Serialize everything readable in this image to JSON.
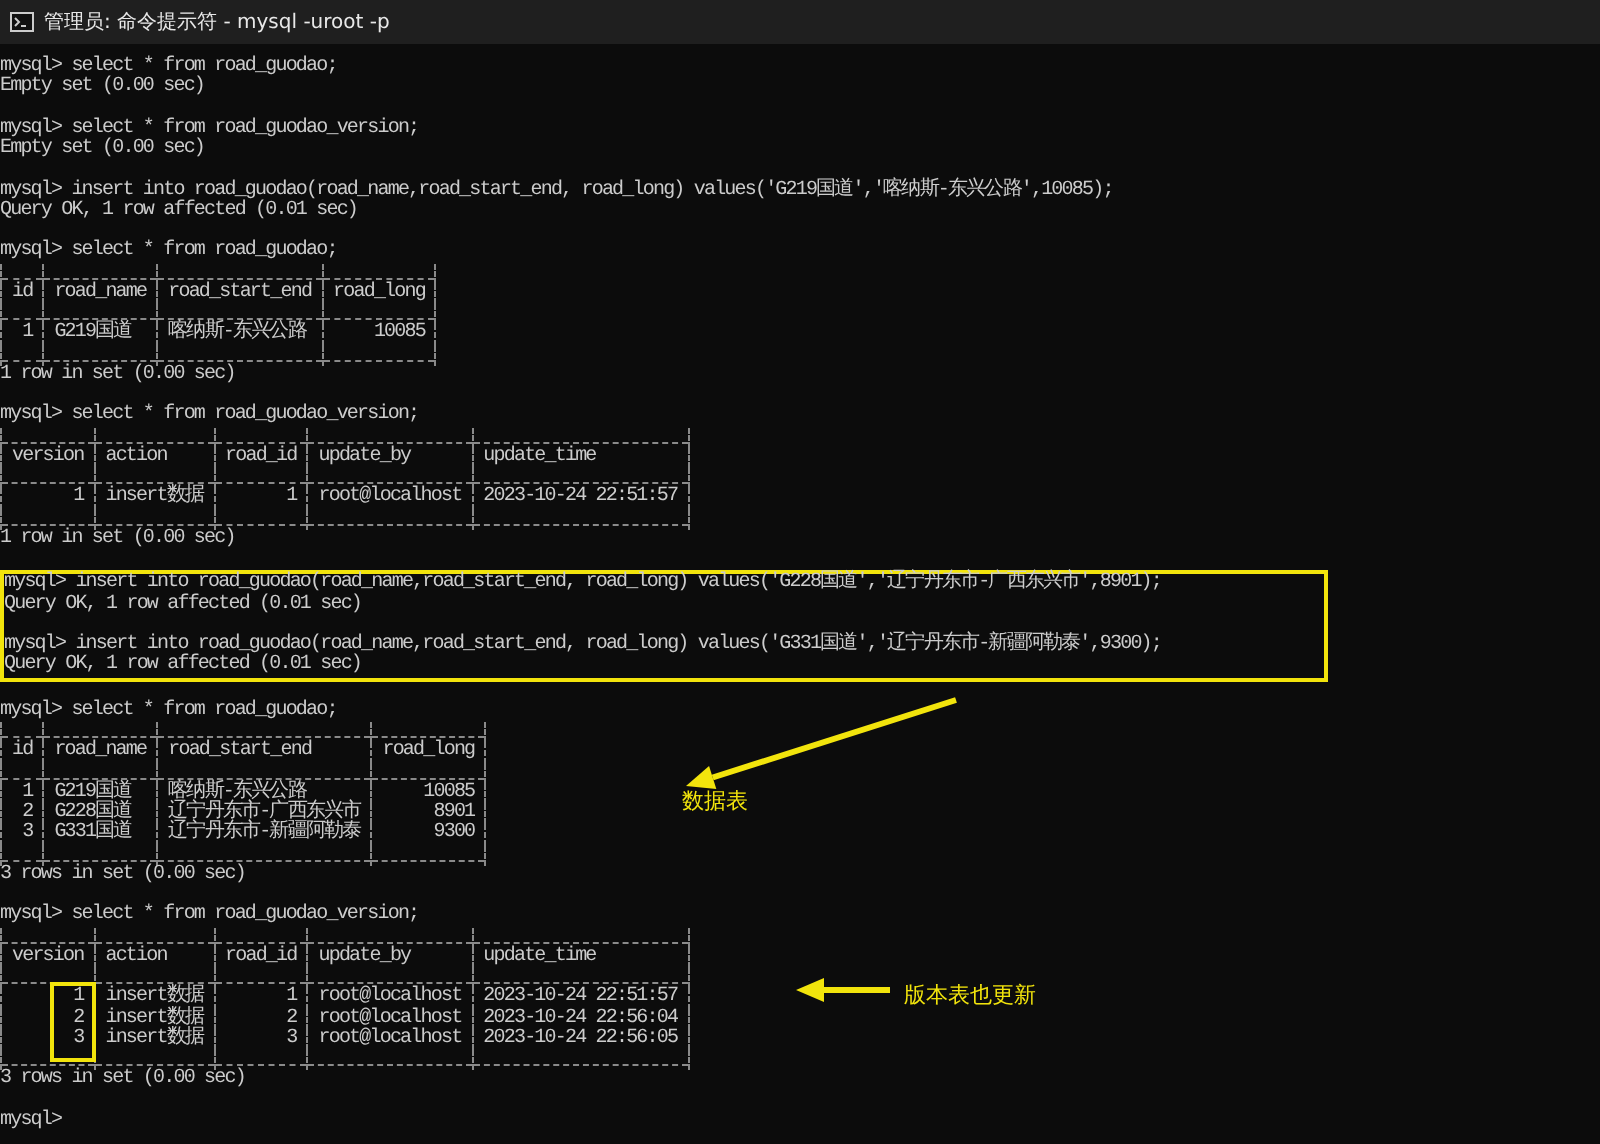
{
  "window": {
    "title": "管理员: 命令提示符 - mysql -uroot -p"
  },
  "terminal": {
    "blocks": [
      {
        "kind": "line",
        "text": "mysql> select * from road_guodao;"
      },
      {
        "kind": "line",
        "text": "Empty set (0.00 sec)"
      },
      {
        "kind": "blank"
      },
      {
        "kind": "line",
        "text": "mysql> select * from road_guodao_version;"
      },
      {
        "kind": "line",
        "text": "Empty set (0.00 sec)"
      },
      {
        "kind": "blank"
      },
      {
        "kind": "line",
        "text": "mysql> insert into road_guodao(road_name,road_start_end, road_long) values('G219国道','喀纳斯-东兴公路',10085);"
      },
      {
        "kind": "line",
        "text": "Query OK, 1 row affected (0.01 sec)"
      },
      {
        "kind": "blank"
      },
      {
        "kind": "line",
        "text": "mysql> select * from road_guodao;"
      },
      {
        "kind": "table",
        "columns": [
          {
            "label": "id",
            "kind": "number"
          },
          {
            "label": "road_name",
            "kind": "text"
          },
          {
            "label": "road_start_end",
            "kind": "text"
          },
          {
            "label": "road_long",
            "kind": "number"
          }
        ],
        "rows": [
          [
            "1",
            "G219国道",
            "喀纳斯-东兴公路",
            "10085"
          ]
        ]
      },
      {
        "kind": "line",
        "text": "1 row in set (0.00 sec)"
      },
      {
        "kind": "blank"
      },
      {
        "kind": "line",
        "text": "mysql> select * from road_guodao_version;"
      },
      {
        "kind": "table",
        "columns": [
          {
            "label": "version",
            "kind": "number"
          },
          {
            "label": "action",
            "kind": "text"
          },
          {
            "label": "road_id",
            "kind": "number"
          },
          {
            "label": "update_by",
            "kind": "text"
          },
          {
            "label": "update_time",
            "kind": "text"
          }
        ],
        "rows": [
          [
            "1",
            "insert数据",
            "1",
            "root@localhost",
            "2023-10-24 22:51:57"
          ]
        ]
      },
      {
        "kind": "line",
        "text": "1 row in set (0.00 sec)"
      },
      {
        "kind": "blank"
      },
      {
        "kind": "highlight",
        "blocks": [
          {
            "kind": "line",
            "text": "mysql> insert into road_guodao(road_name,road_start_end, road_long) values('G228国道','辽宁丹东市-广西东兴市',8901);"
          },
          {
            "kind": "line",
            "text": "Query OK, 1 row affected (0.01 sec)"
          },
          {
            "kind": "blank"
          },
          {
            "kind": "line",
            "text": "mysql> insert into road_guodao(road_name,road_start_end, road_long) values('G331国道','辽宁丹东市-新疆阿勒泰',9300);"
          },
          {
            "kind": "line",
            "text": "Query OK, 1 row affected (0.01 sec)"
          }
        ]
      },
      {
        "kind": "blank"
      },
      {
        "kind": "line",
        "text": "mysql> select * from road_guodao;"
      },
      {
        "kind": "table",
        "columns": [
          {
            "label": "id",
            "kind": "number"
          },
          {
            "label": "road_name",
            "kind": "text"
          },
          {
            "label": "road_start_end",
            "kind": "text"
          },
          {
            "label": "road_long",
            "kind": "number"
          }
        ],
        "rows": [
          [
            "1",
            "G219国道",
            "喀纳斯-东兴公路",
            "10085"
          ],
          [
            "2",
            "G228国道",
            "辽宁丹东市-广西东兴市",
            "8901"
          ],
          [
            "3",
            "G331国道",
            "辽宁丹东市-新疆阿勒泰",
            "9300"
          ]
        ]
      },
      {
        "kind": "line",
        "text": "3 rows in set (0.00 sec)"
      },
      {
        "kind": "blank"
      },
      {
        "kind": "line",
        "text": "mysql> select * from road_guodao_version;"
      },
      {
        "kind": "table",
        "columns": [
          {
            "label": "version",
            "kind": "number",
            "boxed": true
          },
          {
            "label": "action",
            "kind": "text",
            "boxed": false
          },
          {
            "label": "road_id",
            "kind": "number",
            "boxed": false
          },
          {
            "label": "update_by",
            "kind": "text",
            "boxed": false
          },
          {
            "label": "update_time",
            "kind": "text",
            "boxed": false
          }
        ],
        "rows": [
          [
            "1",
            "insert数据",
            "1",
            "root@localhost",
            "2023-10-24 22:51:57"
          ],
          [
            "2",
            "insert数据",
            "2",
            "root@localhost",
            "2023-10-24 22:56:04"
          ],
          [
            "3",
            "insert数据",
            "3",
            "root@localhost",
            "2023-10-24 22:56:05"
          ]
        ]
      },
      {
        "kind": "line",
        "text": "3 rows in set (0.00 sec)"
      },
      {
        "kind": "blank"
      },
      {
        "kind": "line",
        "text": "mysql>"
      }
    ]
  },
  "annotations": [
    {
      "text": "数据表"
    },
    {
      "text": "版本表也更新"
    }
  ]
}
